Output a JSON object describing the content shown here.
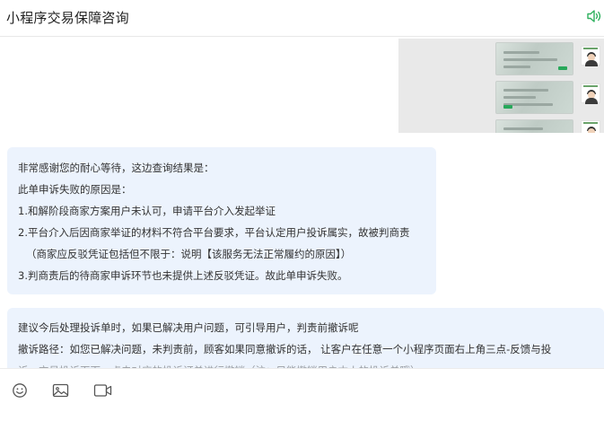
{
  "header": {
    "title": "小程序交易保障咨询"
  },
  "image_message": {
    "thumbnails": [
      "screenshot-1",
      "screenshot-2",
      "screenshot-3"
    ]
  },
  "messages": [
    {
      "lines": [
        "非常感谢您的耐心等待，这边查询结果是：",
        "此单申诉失败的原因是：",
        "1.和解阶段商家方案用户未认可，申请平台介入发起举证",
        "2.平台介入后因商家举证的材料不符合平台要求，平台认定用户投诉属实，故被判商责",
        "（商家应反驳凭证包括但不限于：说明【该服务无法正常履约的原因】）",
        "3.判商责后的待商家申诉环节也未提供上述反驳凭证。故此单申诉失败。"
      ]
    },
    {
      "lines": [
        "建议今后处理投诉单时，如果已解决用户问题，可引导用户，判责前撤诉呢",
        "撤诉路径：如您已解决问题，未判责前，顾客如果同意撤诉的话， 让客户在任意一个小程序页面右上角三点-反馈与投",
        "诉—交易投诉页面—点击对应的投诉订单进行撤销（注：只能撤销用户本人的投诉单哦）"
      ]
    }
  ],
  "toolbar": {
    "icons": [
      "emoji-icon",
      "image-icon",
      "video-icon"
    ]
  },
  "colors": {
    "bubble": "#ecf3fd",
    "accent": "#2fb15f"
  }
}
